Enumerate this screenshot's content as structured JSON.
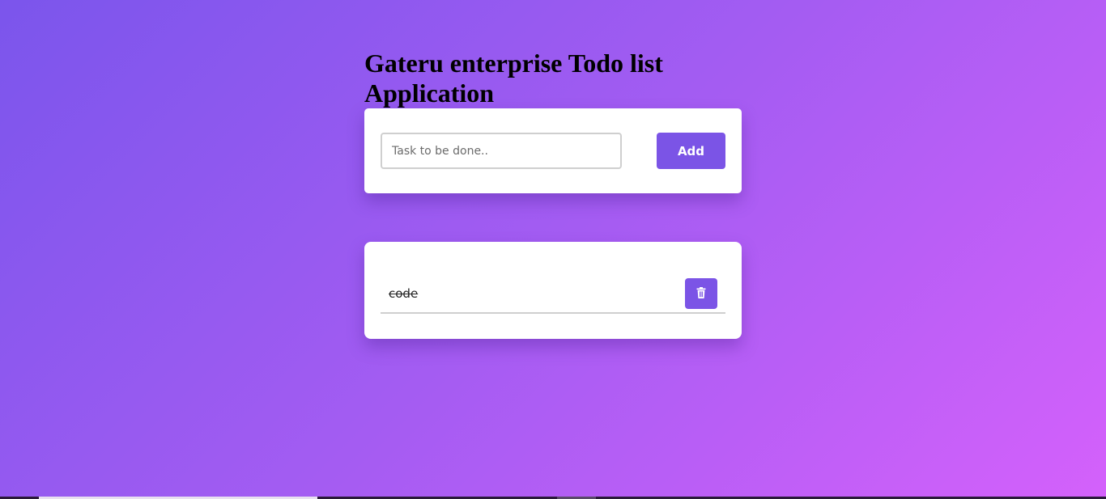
{
  "header": {
    "title": "Gateru enterprise Todo list Application"
  },
  "form": {
    "task_placeholder": "Task to be done..",
    "task_value": "",
    "add_label": "Add"
  },
  "todos": [
    {
      "text": "code",
      "completed": true,
      "delete_icon": "trash-icon"
    }
  ],
  "colors": {
    "accent": "#7b54e6",
    "gradient_start": "#7b55ec",
    "gradient_end": "#d461fb"
  }
}
